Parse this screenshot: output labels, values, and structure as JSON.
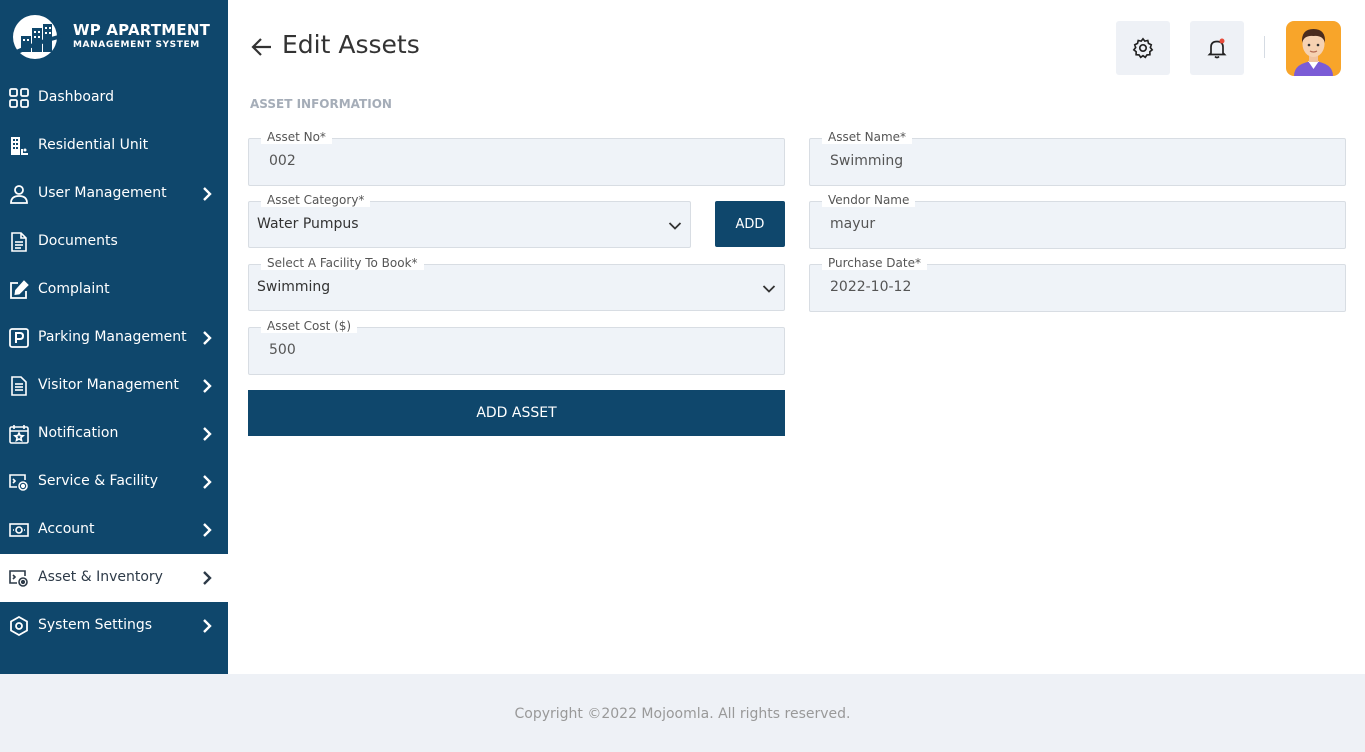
{
  "app": {
    "logo_title": "WP APARTMENT",
    "logo_subtitle": "MANAGEMENT SYSTEM"
  },
  "sidebar": {
    "items": [
      {
        "label": "Dashboard",
        "icon": "grid-icon",
        "has_chevron": false
      },
      {
        "label": "Residential Unit",
        "icon": "building-icon",
        "has_chevron": false
      },
      {
        "label": "User Management",
        "icon": "user-icon",
        "has_chevron": true
      },
      {
        "label": "Documents",
        "icon": "document-icon",
        "has_chevron": false
      },
      {
        "label": "Complaint",
        "icon": "edit-icon",
        "has_chevron": false
      },
      {
        "label": "Parking Management",
        "icon": "parking-icon",
        "has_chevron": true
      },
      {
        "label": "Visitor Management",
        "icon": "clipboard-icon",
        "has_chevron": true
      },
      {
        "label": "Notification",
        "icon": "calendar-star-icon",
        "has_chevron": true
      },
      {
        "label": "Service & Facility",
        "icon": "service-icon",
        "has_chevron": true
      },
      {
        "label": "Account",
        "icon": "money-icon",
        "has_chevron": true
      },
      {
        "label": "Asset & Inventory",
        "icon": "inventory-icon",
        "has_chevron": true,
        "active": true
      },
      {
        "label": "System Settings",
        "icon": "settings-hex-icon",
        "has_chevron": true
      }
    ]
  },
  "header": {
    "title": "Edit Assets",
    "settings_icon": "gear-icon",
    "notification_icon": "bell-icon"
  },
  "form": {
    "section_title": "ASSET INFORMATION",
    "asset_no": {
      "label": "Asset No*",
      "value": "002"
    },
    "asset_name": {
      "label": "Asset Name*",
      "value": "Swimming"
    },
    "asset_category": {
      "label": "Asset Category*",
      "value": "Water Pumpus"
    },
    "vendor_name": {
      "label": "Vendor Name",
      "value": "mayur"
    },
    "facility": {
      "label": "Select A Facility To Book*",
      "value": "Swimming"
    },
    "purchase_date": {
      "label": "Purchase Date*",
      "value": "2022-10-12"
    },
    "asset_cost": {
      "label": "Asset Cost ($)",
      "value": "500"
    },
    "add_button": "ADD",
    "submit_button": "ADD ASSET"
  },
  "footer": {
    "text": "Copyright ©2022 Mojoomla. All rights reserved."
  },
  "colors": {
    "sidebar_bg": "#0f476c",
    "button_bg": "#0f476c",
    "field_bg": "#eff3f8",
    "notification_dot": "#e74c3c",
    "avatar_bg": "#f8a52a"
  }
}
